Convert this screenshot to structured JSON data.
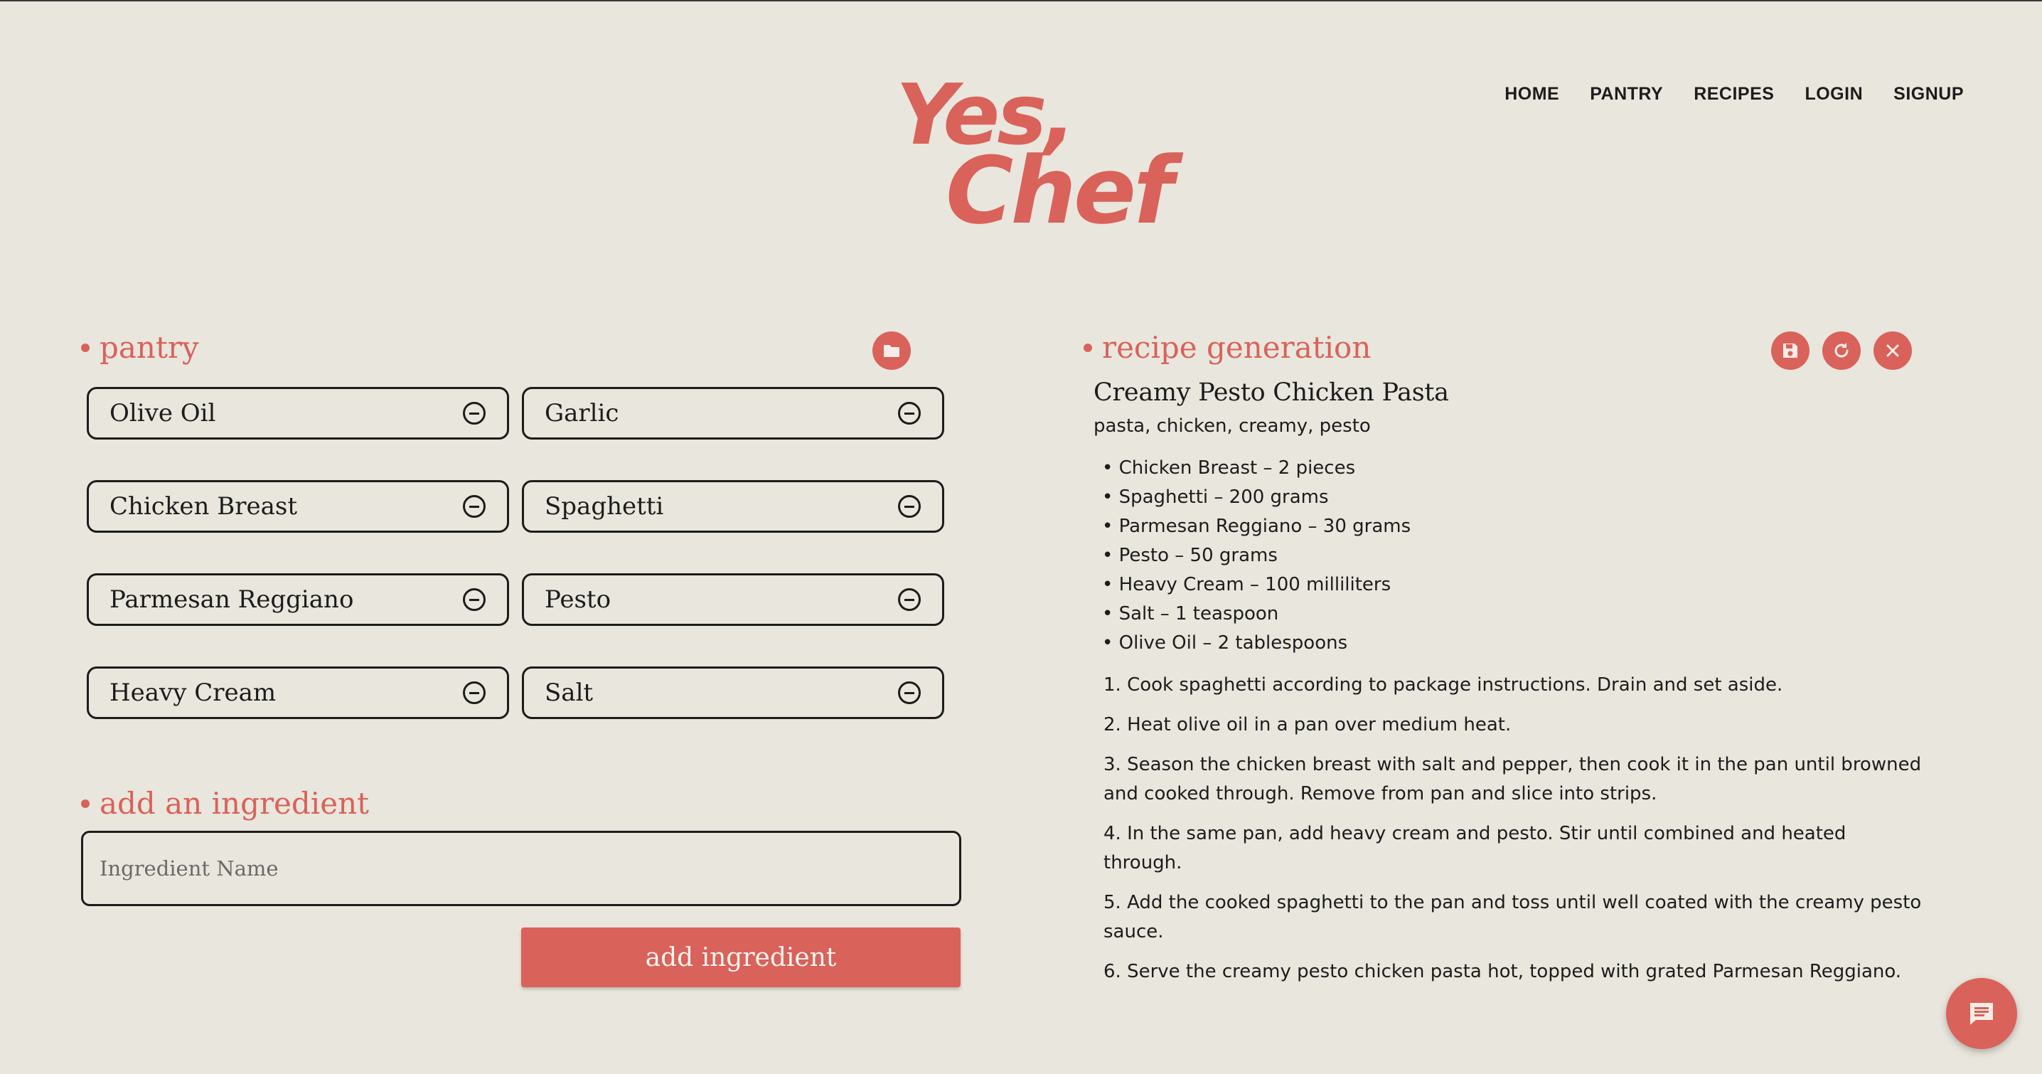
{
  "header": {
    "logo_line1": "Yes,",
    "logo_line2": "Chef",
    "nav": [
      "HOME",
      "PANTRY",
      "RECIPES",
      "LOGIN",
      "SIGNUP"
    ]
  },
  "pantry": {
    "title": "pantry",
    "action_icon": "folder-icon",
    "items": [
      "Olive Oil",
      "Garlic",
      "Chicken Breast",
      "Spaghetti",
      "Parmesan Reggiano",
      "Pesto",
      "Heavy Cream",
      "Salt"
    ]
  },
  "add_ingredient": {
    "title": "add an ingredient",
    "placeholder": "Ingredient Name",
    "value": "",
    "button_label": "add ingredient"
  },
  "recipe": {
    "section_title": "recipe generation",
    "actions": [
      "save-icon",
      "refresh-icon",
      "close-icon"
    ],
    "title": "Creamy Pesto Chicken Pasta",
    "tags": "pasta, chicken, creamy, pesto",
    "ingredients": [
      "• Chicken Breast – 2 pieces",
      "• Spaghetti – 200 grams",
      "• Parmesan Reggiano – 30 grams",
      "• Pesto – 50 grams",
      "• Heavy Cream – 100 milliliters",
      "• Salt – 1 teaspoon",
      "• Olive Oil – 2 tablespoons"
    ],
    "steps": [
      "1. Cook spaghetti according to package instructions. Drain and set aside.",
      "2. Heat olive oil in a pan over medium heat.",
      "3. Season the chicken breast with salt and pepper, then cook it in the pan until browned and cooked through. Remove from pan and slice into strips.",
      "4. In the same pan, add heavy cream and pesto. Stir until combined and heated through.",
      "5. Add the cooked spaghetti to the pan and toss until well coated with the creamy pesto sauce.",
      "6. Serve the creamy pesto chicken pasta hot, topped with grated Parmesan Reggiano."
    ]
  },
  "chat_icon": "chat-icon",
  "colors": {
    "accent": "#d9625a",
    "background": "#e9e6dd",
    "text": "#1c1c1c"
  }
}
